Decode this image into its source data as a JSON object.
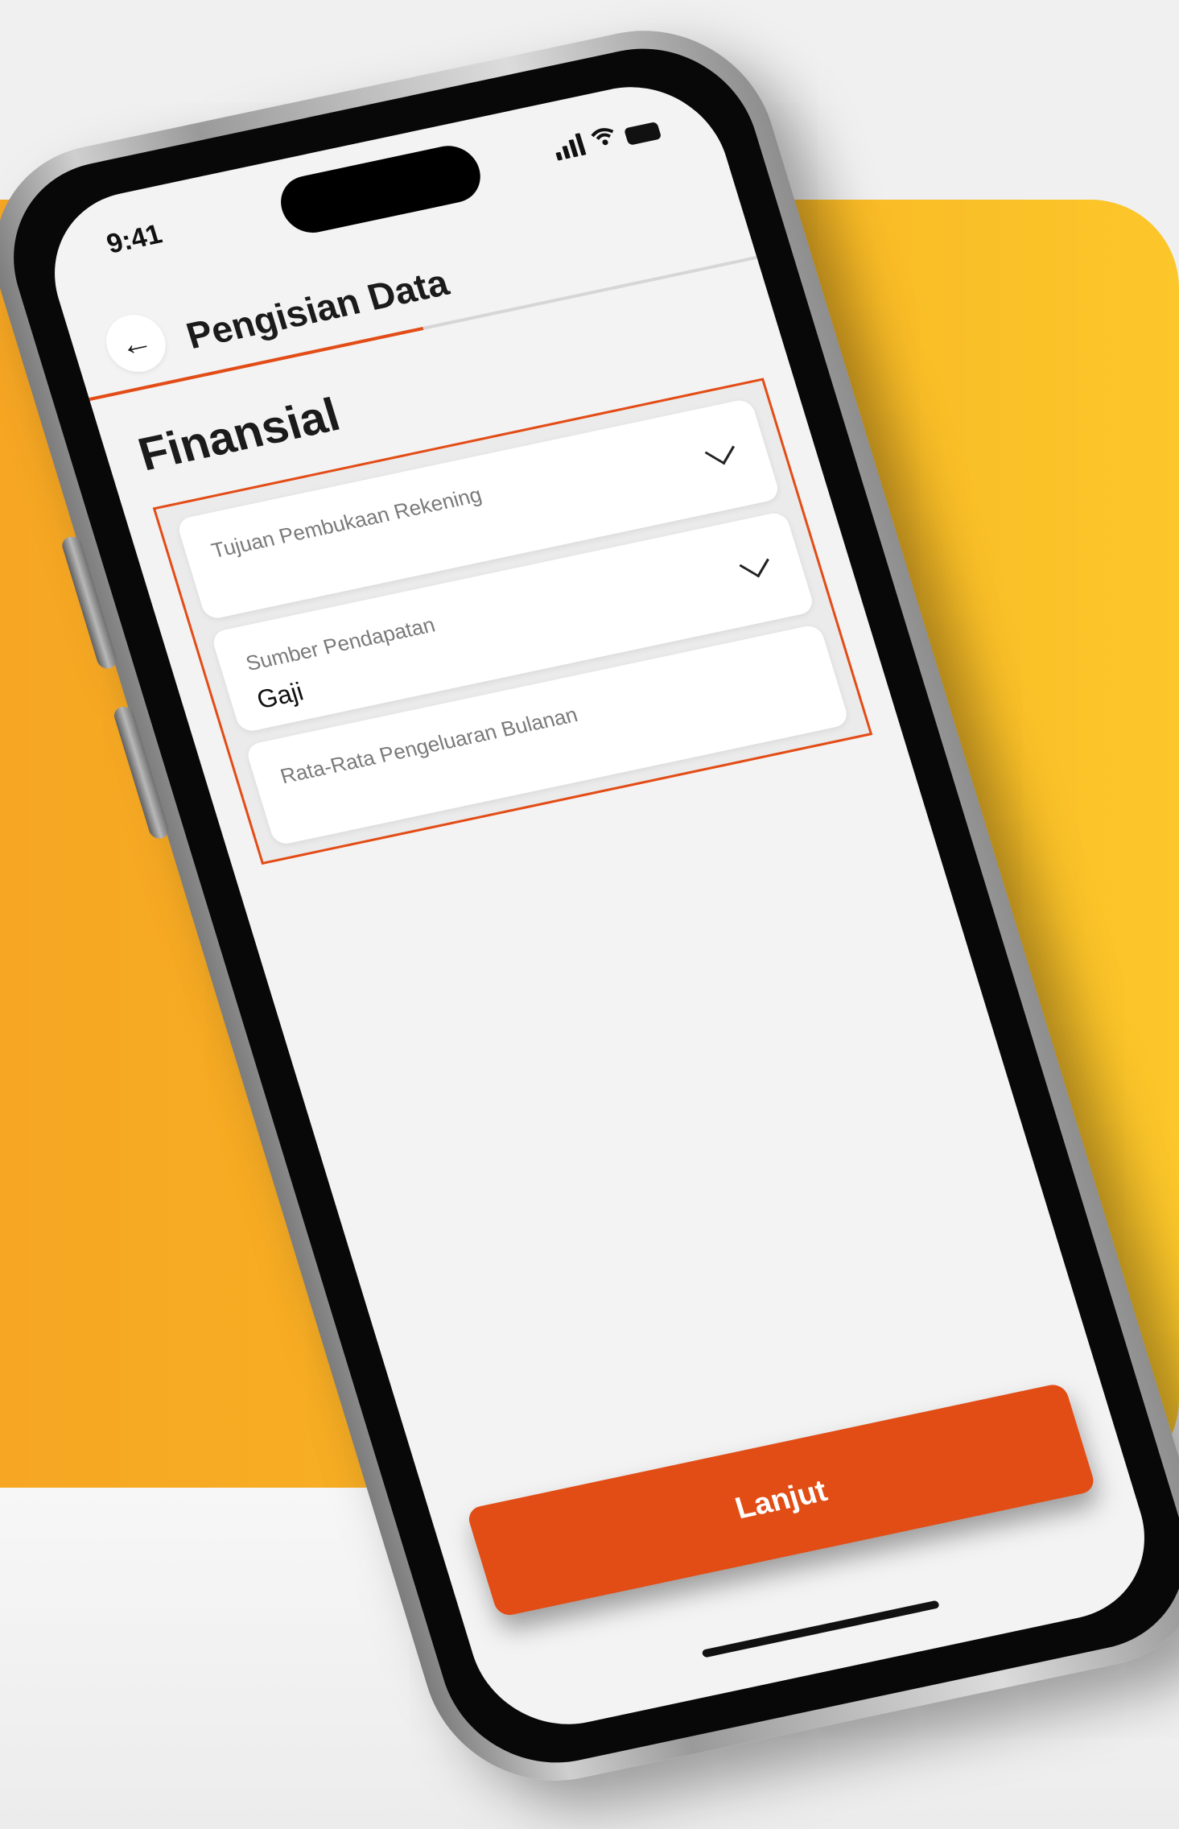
{
  "status_bar": {
    "time": "9:41",
    "signal_icon": "signal-icon",
    "wifi_icon": "wifi-icon",
    "battery_icon": "battery-icon"
  },
  "header": {
    "back_icon": "arrow-left-icon",
    "back_glyph": "←",
    "title": "Pengisian Data"
  },
  "progress": {
    "fraction": 0.5
  },
  "section": {
    "title": "Finansial"
  },
  "form": {
    "fields": [
      {
        "label": "Tujuan Pembukaan Rekening",
        "value": "",
        "type": "dropdown"
      },
      {
        "label": "Sumber Pendapatan",
        "value": "Gaji",
        "type": "dropdown"
      },
      {
        "label": "Rata-Rata Pengeluaran Bulanan",
        "value": "",
        "type": "text"
      }
    ]
  },
  "footer": {
    "cta_label": "Lanjut"
  },
  "colors": {
    "accent": "#e34c16",
    "background_yellow": "#f8b424",
    "screen_background": "#f3f3f3"
  }
}
